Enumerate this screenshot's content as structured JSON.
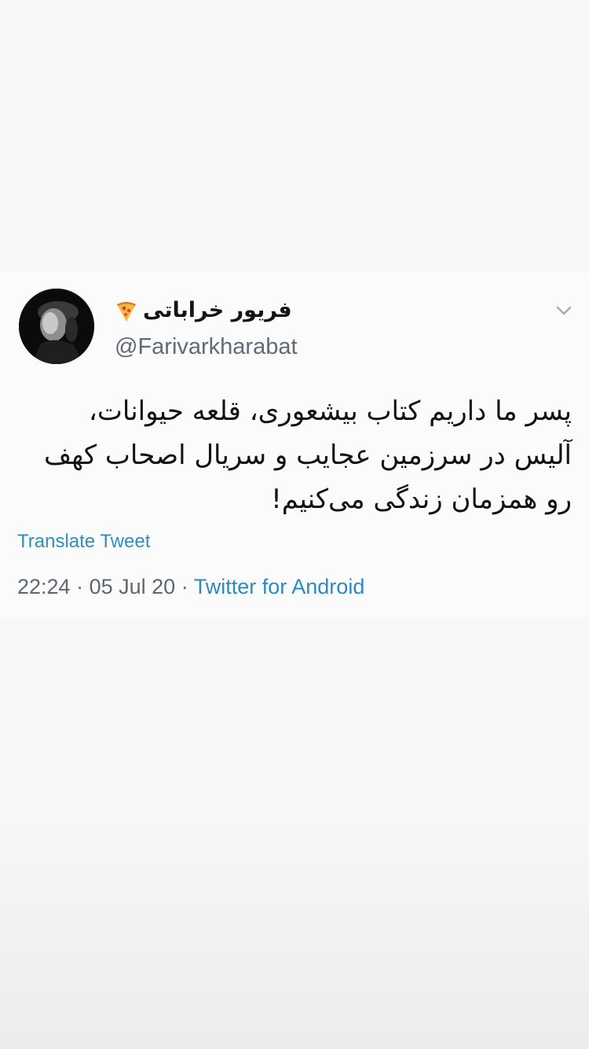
{
  "tweet": {
    "display_name": "فریور خراباتی",
    "name_emoji_icon": "pizza-icon",
    "handle": "@Farivarkharabat",
    "menu_icon": "chevron-down-icon",
    "text": "پسر ما داریم کتاب بیشعوری، قلعه حیوانات،\nآلیس در سرزمین عجایب و سریال اصحاب کهف\nرو همزمان زندگی می‌کنیم!",
    "translate_label": "Translate Tweet",
    "time": "22:24",
    "separator": "·",
    "date": "05 Jul 20",
    "source": "Twitter for Android"
  },
  "colors": {
    "link": "#2f8fbf",
    "meta_text": "#5d6771",
    "body_text": "#121212"
  }
}
